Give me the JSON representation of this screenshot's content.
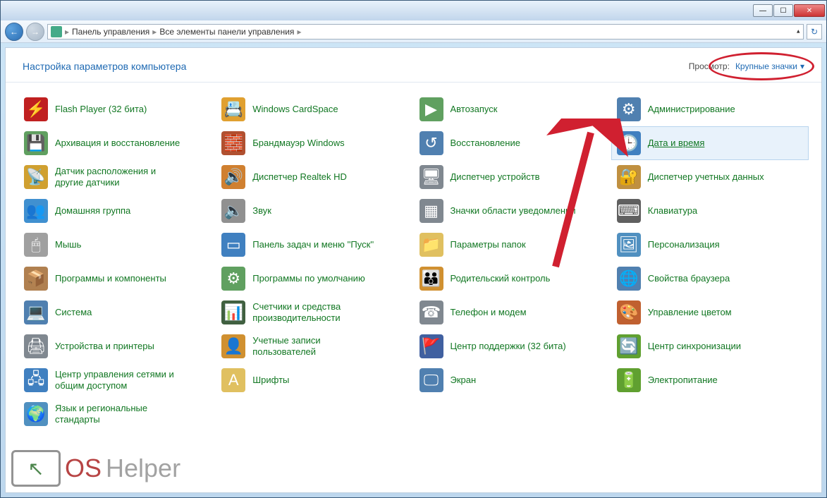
{
  "titlebar": {
    "min": "—",
    "max": "☐",
    "close": "✕"
  },
  "nav": {
    "back": "←",
    "fwd": "→"
  },
  "breadcrumb": {
    "parts": [
      "Панель управления",
      "Все элементы панели управления"
    ],
    "sep": "▸"
  },
  "refresh_icon": "↻",
  "header": {
    "title": "Настройка параметров компьютера",
    "view_label": "Просмотр:",
    "view_value": "Крупные значки",
    "view_arrow": "▾"
  },
  "items": [
    {
      "label": "Flash Player (32 бита)",
      "icon": "⚡",
      "bg": "#c02020"
    },
    {
      "label": "Windows CardSpace",
      "icon": "📇",
      "bg": "#e0a030"
    },
    {
      "label": "Автозапуск",
      "icon": "▶",
      "bg": "#60a060"
    },
    {
      "label": "Администрирование",
      "icon": "⚙",
      "bg": "#5080b0"
    },
    {
      "label": "Архивация и восстановление",
      "icon": "💾",
      "bg": "#60a060"
    },
    {
      "label": "Брандмауэр Windows",
      "icon": "🧱",
      "bg": "#b05030"
    },
    {
      "label": "Восстановление",
      "icon": "↺",
      "bg": "#5080b0"
    },
    {
      "label": "Дата и время",
      "icon": "🕒",
      "bg": "#4080c0",
      "hover": true
    },
    {
      "label": "Датчик расположения и другие датчики",
      "icon": "📡",
      "bg": "#d0a030"
    },
    {
      "label": "Диспетчер Realtek HD",
      "icon": "🔊",
      "bg": "#d08030"
    },
    {
      "label": "Диспетчер устройств",
      "icon": "🖥",
      "bg": "#808890"
    },
    {
      "label": "Диспетчер учетных данных",
      "icon": "🔐",
      "bg": "#c09040"
    },
    {
      "label": "Домашняя группа",
      "icon": "👥",
      "bg": "#4090d0"
    },
    {
      "label": "Звук",
      "icon": "🔈",
      "bg": "#909090"
    },
    {
      "label": "Значки области уведомлений",
      "icon": "▦",
      "bg": "#808890"
    },
    {
      "label": "Клавиатура",
      "icon": "⌨",
      "bg": "#606060"
    },
    {
      "label": "Мышь",
      "icon": "🖱",
      "bg": "#a0a0a0"
    },
    {
      "label": "Панель задач и меню ''Пуск''",
      "icon": "▭",
      "bg": "#4080c0"
    },
    {
      "label": "Параметры папок",
      "icon": "📁",
      "bg": "#e0c060"
    },
    {
      "label": "Персонализация",
      "icon": "🖼",
      "bg": "#5090c0"
    },
    {
      "label": "Программы и компоненты",
      "icon": "📦",
      "bg": "#b08050"
    },
    {
      "label": "Программы по умолчанию",
      "icon": "⚙",
      "bg": "#60a060"
    },
    {
      "label": "Родительский контроль",
      "icon": "👪",
      "bg": "#d09030"
    },
    {
      "label": "Свойства браузера",
      "icon": "🌐",
      "bg": "#5080b0"
    },
    {
      "label": "Система",
      "icon": "💻",
      "bg": "#5080b0"
    },
    {
      "label": "Счетчики и средства производительности",
      "icon": "📊",
      "bg": "#406040"
    },
    {
      "label": "Телефон и модем",
      "icon": "☎",
      "bg": "#808890"
    },
    {
      "label": "Управление цветом",
      "icon": "🎨",
      "bg": "#c06030"
    },
    {
      "label": "Устройства и принтеры",
      "icon": "🖨",
      "bg": "#808890"
    },
    {
      "label": "Учетные записи пользователей",
      "icon": "👤",
      "bg": "#d09030"
    },
    {
      "label": "Центр поддержки (32 бита)",
      "icon": "🚩",
      "bg": "#4060a0"
    },
    {
      "label": "Центр синхронизации",
      "icon": "🔄",
      "bg": "#60a030"
    },
    {
      "label": "Центр управления сетями и общим доступом",
      "icon": "🖧",
      "bg": "#4080c0"
    },
    {
      "label": "Шрифты",
      "icon": "A",
      "bg": "#e0c060"
    },
    {
      "label": "Экран",
      "icon": "🖵",
      "bg": "#5080b0"
    },
    {
      "label": "Электропитание",
      "icon": "🔋",
      "bg": "#60a030"
    },
    {
      "label": "Язык и региональные стандарты",
      "icon": "🌍",
      "bg": "#5090c0"
    }
  ],
  "watermark": {
    "os": "OS",
    "helper": "Helper",
    "cursor": "↖"
  }
}
